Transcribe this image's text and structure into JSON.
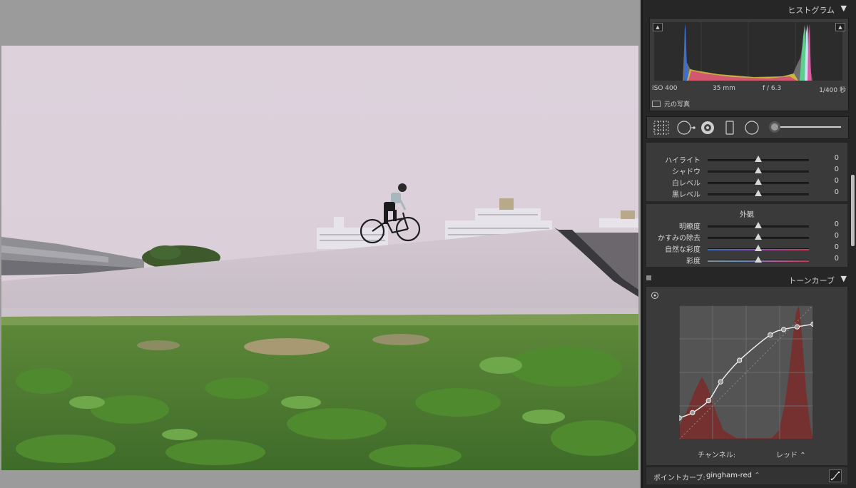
{
  "histogram": {
    "title": "ヒストグラム",
    "iso": "ISO 400",
    "focal": "35 mm",
    "aperture": "f / 6.3",
    "shutter": "1/400 秒",
    "original_photo": "元の写真"
  },
  "basic": {
    "rows": [
      {
        "label": "ハイライト",
        "value": "0"
      },
      {
        "label": "シャドウ",
        "value": "0"
      },
      {
        "label": "白レベル",
        "value": "0"
      },
      {
        "label": "黒レベル",
        "value": "0"
      }
    ]
  },
  "presence": {
    "title": "外観",
    "rows": [
      {
        "label": "明瞭度",
        "value": "0"
      },
      {
        "label": "かすみの除去",
        "value": "0"
      },
      {
        "label": "自然な彩度",
        "value": "0"
      },
      {
        "label": "彩度",
        "value": "0"
      }
    ]
  },
  "tone_curve": {
    "title": "トーンカーブ",
    "channel_label": "チャンネル:",
    "channel_value": "レッド",
    "point_curve_label": "ポイントカーブ:",
    "point_curve_value": "gingham-red",
    "points": [
      [
        0,
        0.16
      ],
      [
        0.1,
        0.2
      ],
      [
        0.22,
        0.29
      ],
      [
        0.31,
        0.43
      ],
      [
        0.45,
        0.59
      ],
      [
        0.68,
        0.78
      ],
      [
        0.78,
        0.82
      ],
      [
        0.88,
        0.84
      ],
      [
        1,
        0.86
      ]
    ]
  },
  "icons": [
    "clip-shadow-icon",
    "clip-highlight-icon",
    "crop-grid-icon",
    "spot-removal-icon",
    "redeye-icon",
    "graduated-filter-icon",
    "radial-filter-icon",
    "adjustment-brush-icon",
    "target-adjust-icon",
    "point-curve-edit-icon"
  ]
}
